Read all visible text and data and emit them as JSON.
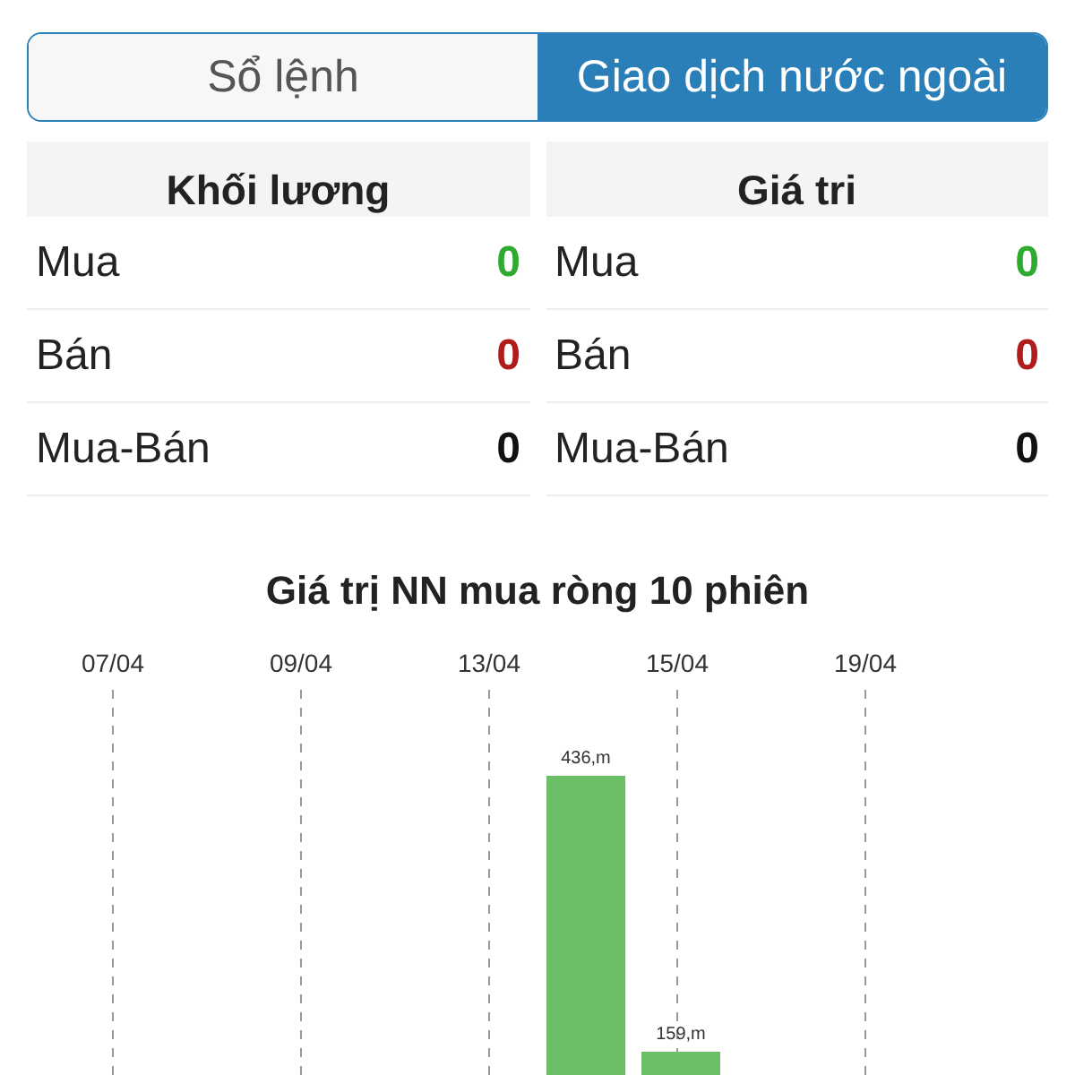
{
  "tabs": [
    {
      "label": "Sổ lệnh",
      "selected": false
    },
    {
      "label": "Giao dịch nước ngoài",
      "selected": true
    }
  ],
  "tables": [
    {
      "header": "Khối lương",
      "rows": [
        {
          "label": "Mua",
          "value": "0",
          "kind": "buy"
        },
        {
          "label": "Bán",
          "value": "0",
          "kind": "sell"
        },
        {
          "label": "Mua-Bán",
          "value": "0",
          "kind": "net"
        }
      ]
    },
    {
      "header": "Giá tri",
      "rows": [
        {
          "label": "Mua",
          "value": "0",
          "kind": "buy"
        },
        {
          "label": "Bán",
          "value": "0",
          "kind": "sell"
        },
        {
          "label": "Mua-Bán",
          "value": "0",
          "kind": "net"
        }
      ]
    }
  ],
  "chart": {
    "title": "Giá trị NN mua ròng 10 phiên",
    "date_labels": [
      "07/04",
      "09/04",
      "13/04",
      "15/04",
      "19/04"
    ],
    "bar_labels": [
      "436,m",
      "159,m"
    ]
  }
}
